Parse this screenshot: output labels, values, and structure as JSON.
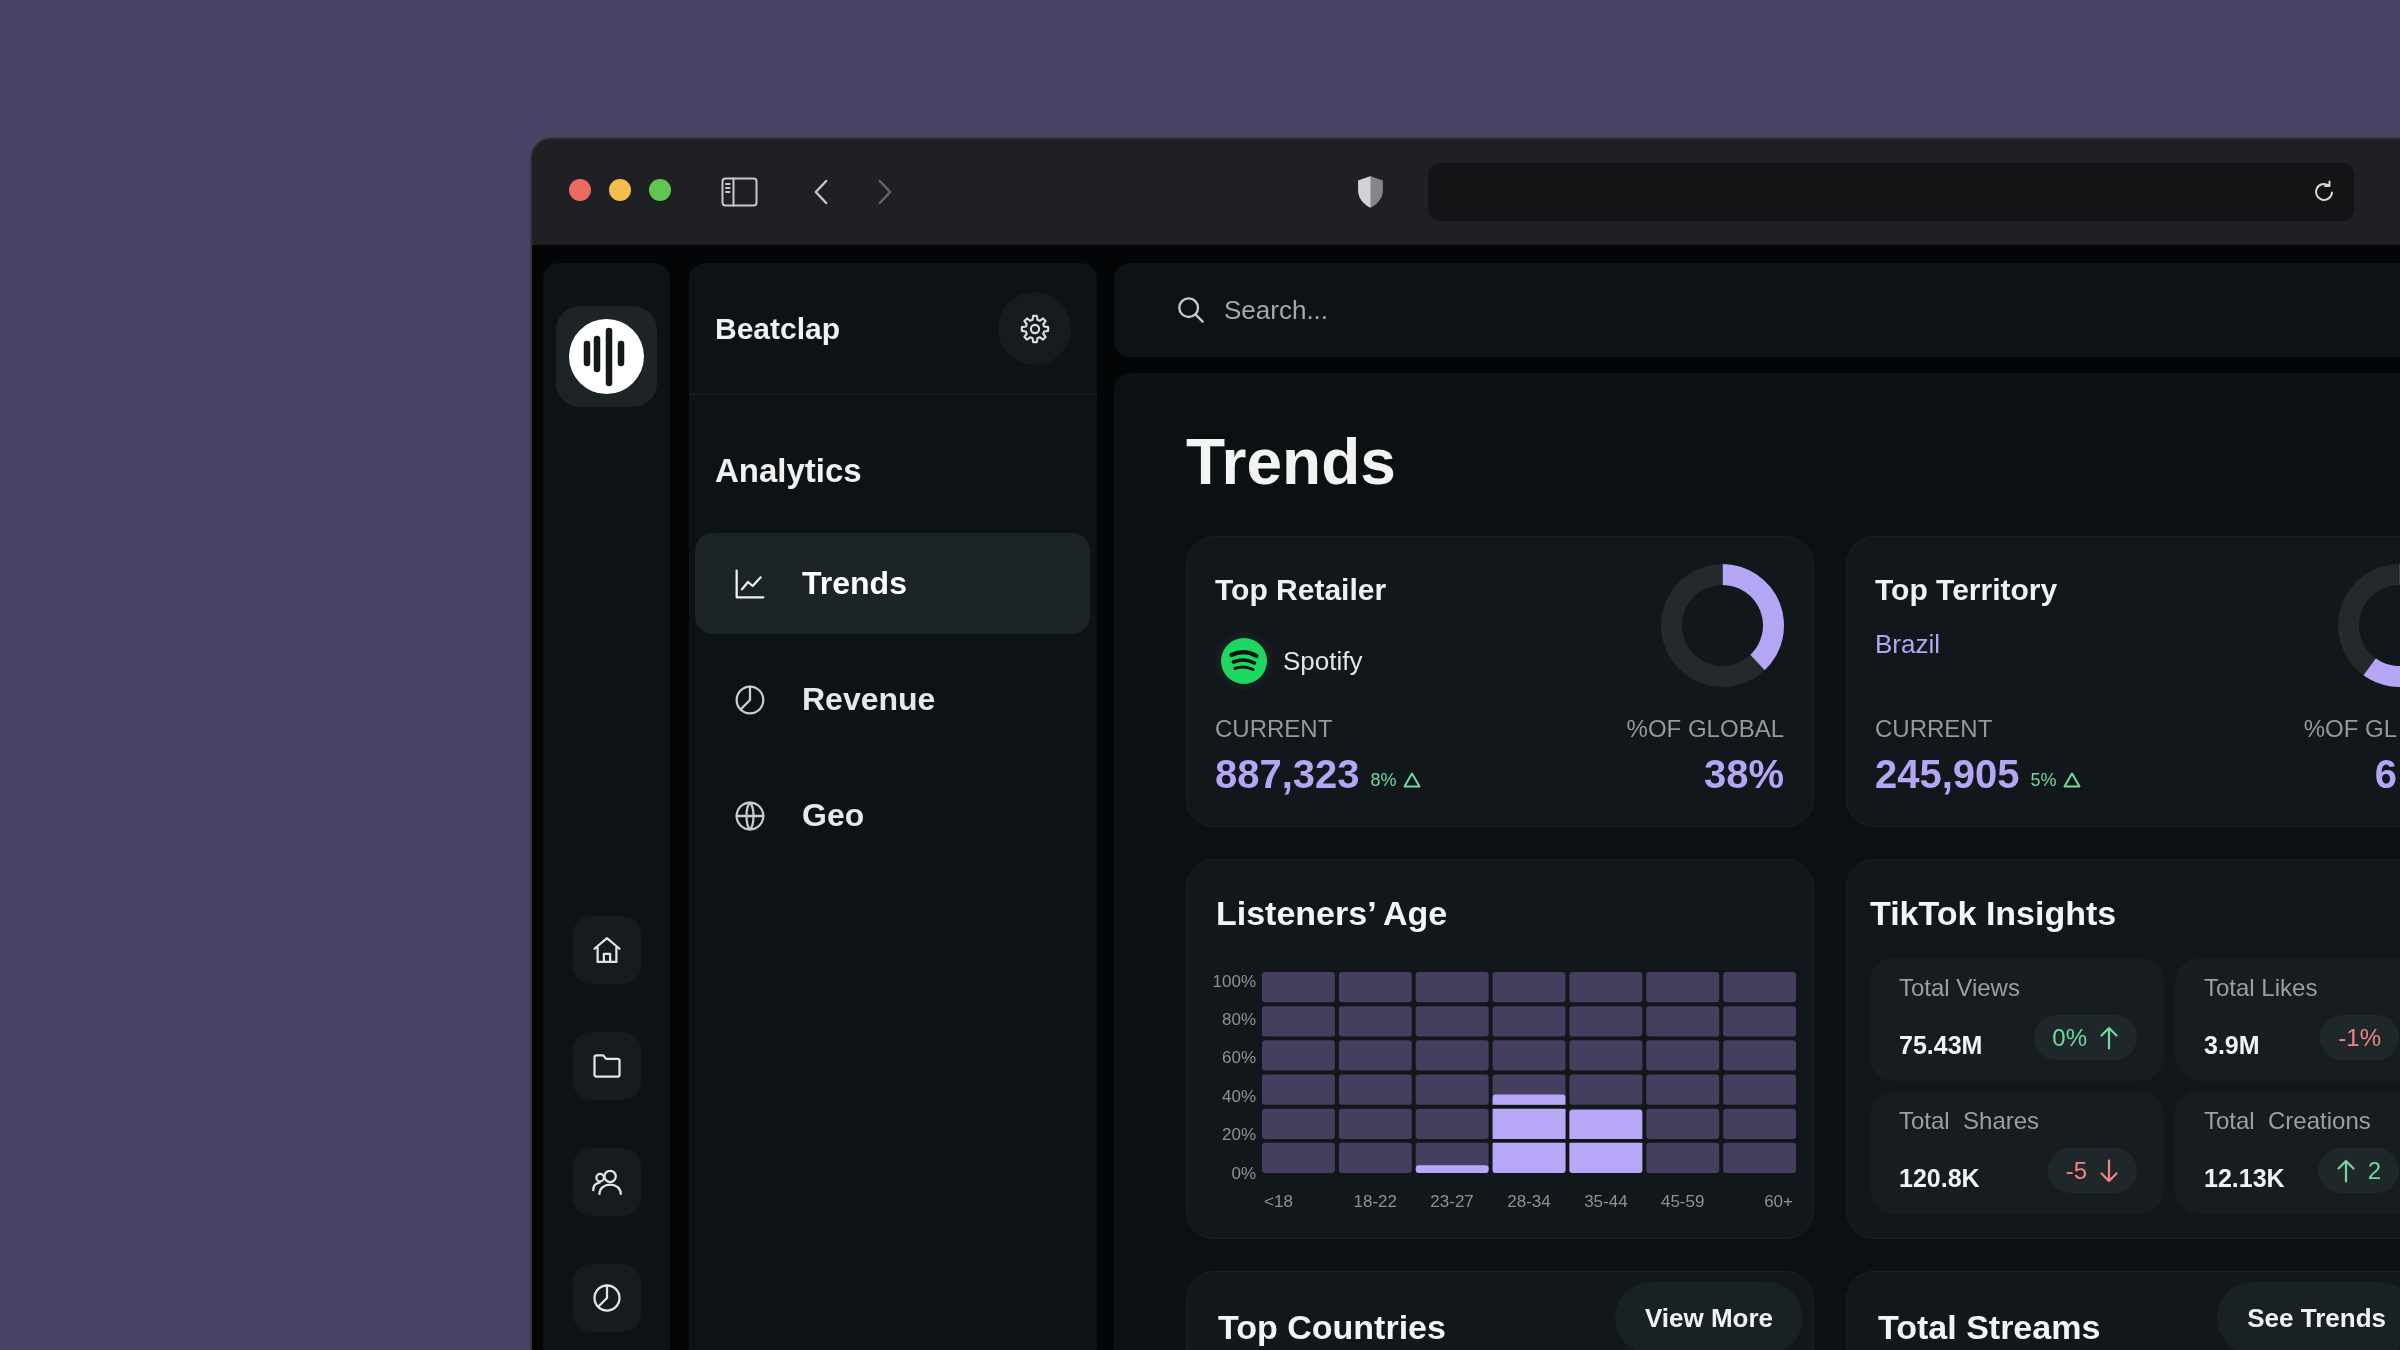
{
  "browser": {
    "back": {
      "disabled": false
    },
    "forward": {
      "disabled": true
    }
  },
  "sidebar": {
    "title": "Beatclap",
    "section": "Analytics",
    "items": [
      {
        "label": "Trends",
        "selected": true
      },
      {
        "label": "Revenue",
        "selected": false
      },
      {
        "label": "Geo",
        "selected": false
      }
    ]
  },
  "search": {
    "placeholder": "Search..."
  },
  "page_title": "Trends",
  "stat_cards": [
    {
      "kind": "retailer",
      "title": "Top Retailer",
      "subtitle": "Spotify",
      "chart_data": {
        "type": "donut",
        "values": [
          38,
          62
        ]
      },
      "current_label": "CURRENT",
      "current_value": "887,323",
      "change": {
        "text": "8%",
        "rising": true
      },
      "share_label": "%OF GLOBAL",
      "share_value": "38%"
    },
    {
      "kind": "territory",
      "title": "Top Territory",
      "subtitle": "Brazil",
      "chart_data": {
        "type": "donut",
        "values": [
          60,
          40
        ]
      },
      "current_label": "CURRENT",
      "current_value": "245,905",
      "change": {
        "text": "5%",
        "rising": true
      },
      "share_label": "%OF GL",
      "share_value": "6"
    }
  ],
  "listeners_age": {
    "title": "Listeners’ Age",
    "chart_data": {
      "type": "bar",
      "categories": [
        "<18",
        "18-22",
        "23-27",
        "28-34",
        "35-44",
        "45-59",
        "60+"
      ],
      "values": [
        0,
        0,
        4,
        41,
        33,
        0,
        0
      ],
      "ylim": [
        0,
        100
      ],
      "yticks": [
        {
          "value": 0,
          "label": "0%"
        },
        {
          "value": 20,
          "label": "20%"
        },
        {
          "value": 40,
          "label": "40%"
        },
        {
          "value": 60,
          "label": "60%"
        },
        {
          "value": 80,
          "label": "80%"
        },
        {
          "value": 100,
          "label": "100%"
        }
      ]
    }
  },
  "tiktok_insights": {
    "title": "TikTok Insights",
    "tiles": [
      {
        "label": "Total Views",
        "value": "75.43M",
        "badge": {
          "kind": "value-arrow",
          "text": "0%",
          "rising": true
        }
      },
      {
        "label": "Total Likes",
        "value": "3.9M",
        "badge": {
          "kind": "value",
          "text": "-1%",
          "rising": false
        }
      },
      {
        "label": "Total  Shares",
        "value": "120.8K",
        "badge": {
          "kind": "value-arrow",
          "text": "-5",
          "rising": false
        }
      },
      {
        "label": "Total  Creations",
        "value": "12.13K",
        "badge": {
          "kind": "arrow-value",
          "text": "2",
          "rising": true
        }
      }
    ]
  },
  "bottom_cards": [
    {
      "title": "Top Countries",
      "button": "View More"
    },
    {
      "title": "Total Streams",
      "button": "See Trends"
    }
  ]
}
